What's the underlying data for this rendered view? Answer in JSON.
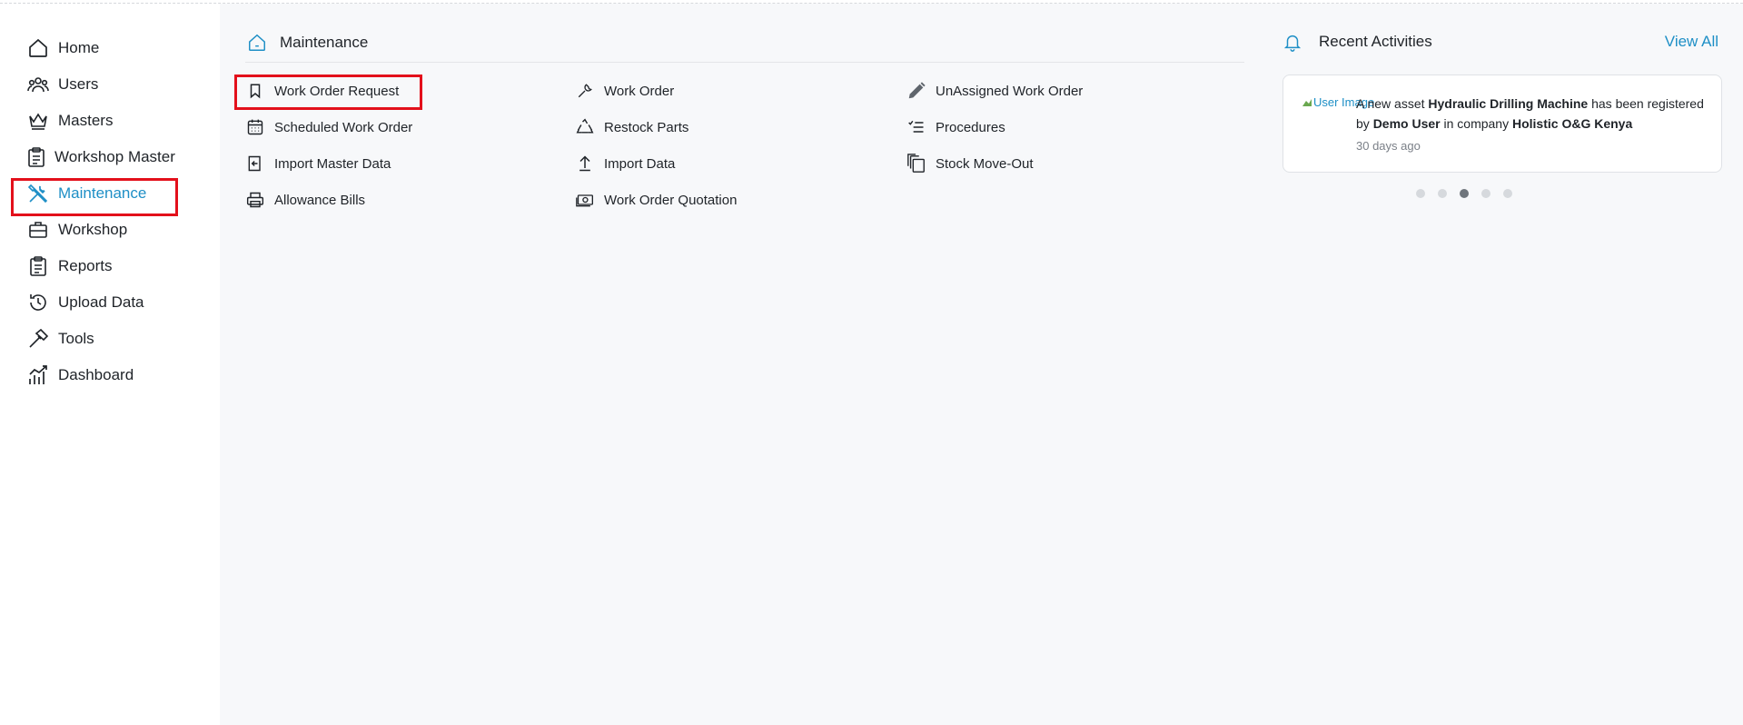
{
  "sidebar": {
    "items": [
      {
        "label": "Home",
        "icon": "home-icon"
      },
      {
        "label": "Users",
        "icon": "users-icon"
      },
      {
        "label": "Masters",
        "icon": "crown-icon"
      },
      {
        "label": "Workshop Master",
        "icon": "clipboard-icon"
      },
      {
        "label": "Maintenance",
        "icon": "tools-icon",
        "active": true
      },
      {
        "label": "Workshop",
        "icon": "briefcase-icon"
      },
      {
        "label": "Reports",
        "icon": "clipboard-list-icon"
      },
      {
        "label": "Upload Data",
        "icon": "history-icon"
      },
      {
        "label": "Tools",
        "icon": "hammer-icon"
      },
      {
        "label": "Dashboard",
        "icon": "chart-bars-icon"
      }
    ]
  },
  "main": {
    "title": "Maintenance",
    "title_icon": "home-icon",
    "menu": [
      {
        "label": "Work Order Request",
        "icon": "bookmark-icon"
      },
      {
        "label": "Work Order",
        "icon": "wrench-icon"
      },
      {
        "label": "UnAssigned Work Order",
        "icon": "pencil-icon"
      },
      {
        "label": "Scheduled Work Order",
        "icon": "calendar-icon"
      },
      {
        "label": "Restock Parts",
        "icon": "recycle-icon"
      },
      {
        "label": "Procedures",
        "icon": "checklist-icon"
      },
      {
        "label": "Import Master Data",
        "icon": "import-icon"
      },
      {
        "label": "Import Data",
        "icon": "upload-icon"
      },
      {
        "label": "Stock Move-Out",
        "icon": "copy-icon"
      },
      {
        "label": "Allowance Bills",
        "icon": "printer-icon"
      },
      {
        "label": "Work Order Quotation",
        "icon": "cash-icon"
      }
    ]
  },
  "recent": {
    "title": "Recent Activities",
    "view_all": "View All",
    "card": {
      "image_alt": "User Image",
      "text_1": "A new asset ",
      "asset": "Hydraulic Drilling Machine",
      "text_2": " has been registered by ",
      "user": "Demo User",
      "text_3": " in company ",
      "company": "Holistic O&G Kenya",
      "time": "30 days ago"
    },
    "dots": {
      "count": 5,
      "active_index": 2
    }
  },
  "colors": {
    "accent": "#1e8fc6",
    "highlight": "#e3101b",
    "main_bg": "#f7f8fa"
  }
}
